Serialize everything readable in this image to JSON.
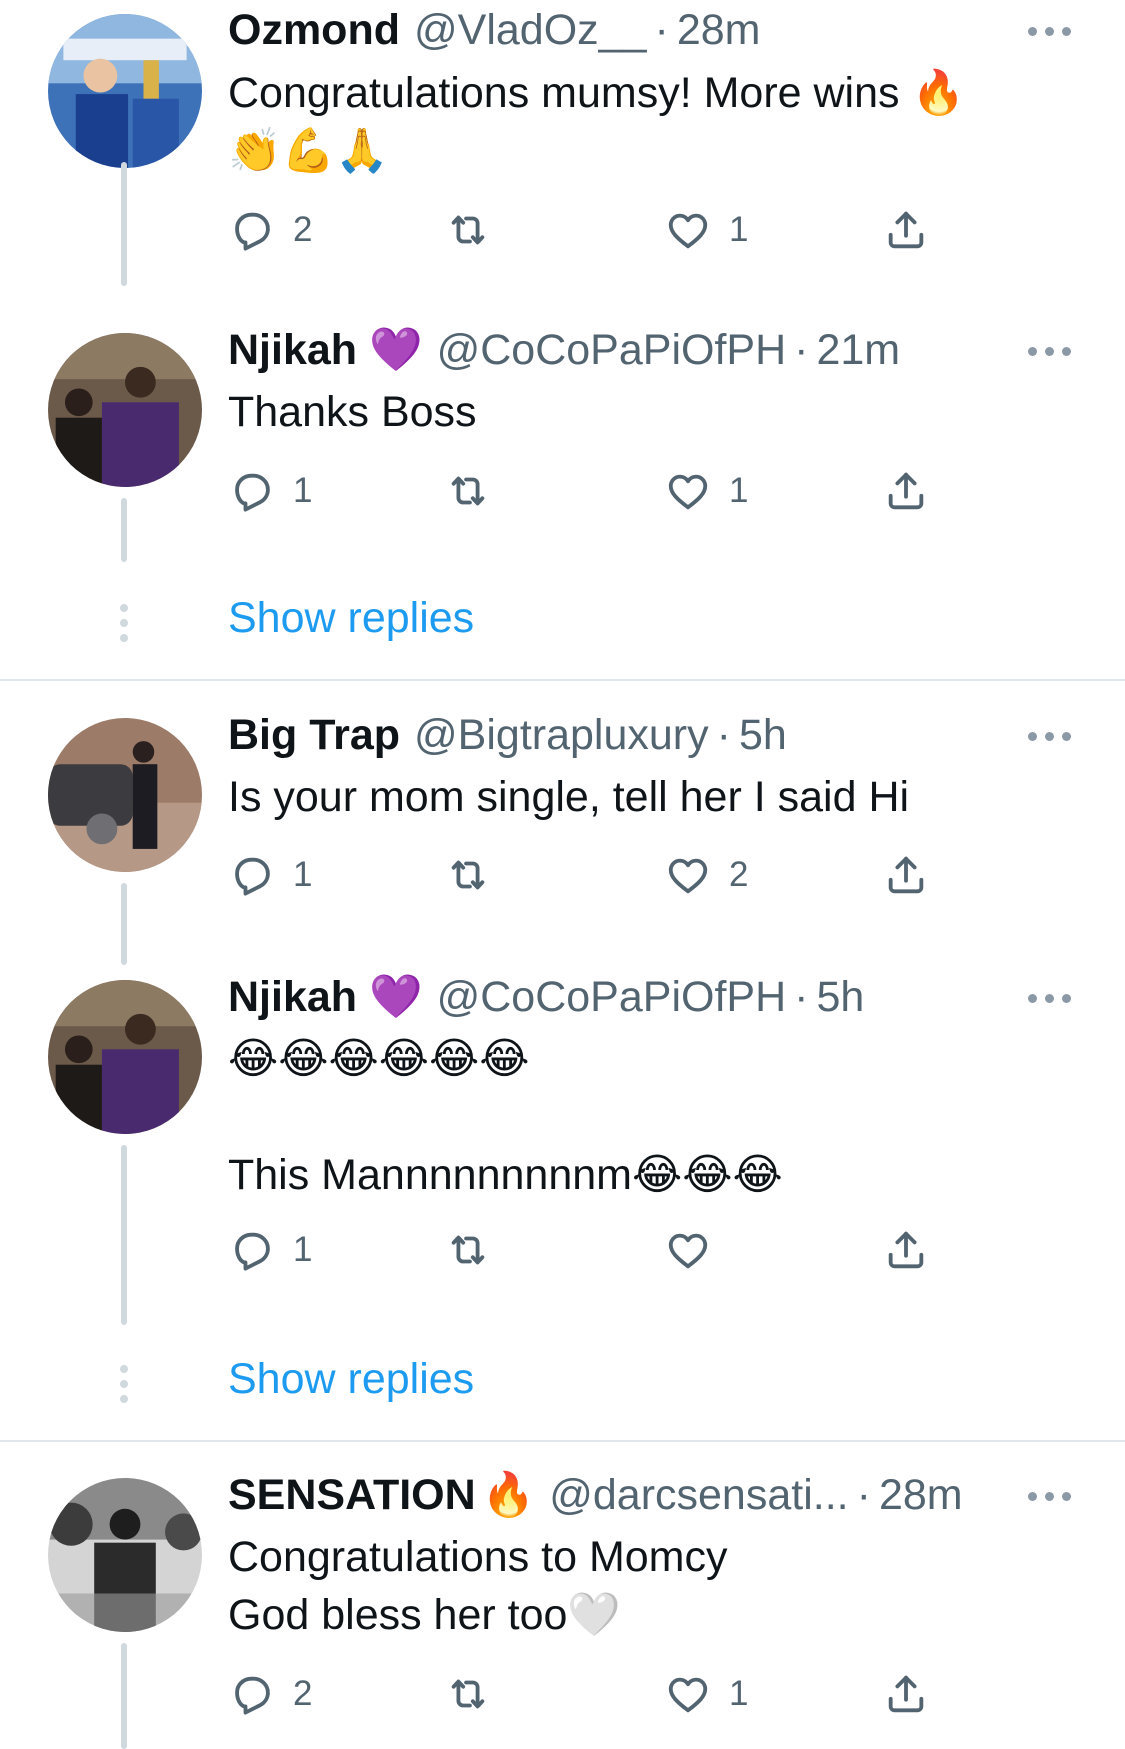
{
  "tweets": [
    {
      "name": "Ozmond",
      "handle": "@VladOz__",
      "separator": "·",
      "time": "28m",
      "name_emoji": "",
      "lines": [
        "Congratulations mumsy! More wins 🔥",
        "👏💪🙏"
      ],
      "replies": "2",
      "retweets": "",
      "likes": "1"
    },
    {
      "name": "Njikah",
      "handle": "@CoCoPaPiOfPH",
      "separator": "·",
      "time": "21m",
      "name_emoji": "💜",
      "lines": [
        "Thanks Boss"
      ],
      "replies": "1",
      "retweets": "",
      "likes": "1"
    },
    {
      "name": "Big Trap",
      "handle": "@Bigtrapluxury",
      "separator": "·",
      "time": "5h",
      "name_emoji": "",
      "lines": [
        "Is your mom single, tell her I said Hi"
      ],
      "replies": "1",
      "retweets": "",
      "likes": "2"
    },
    {
      "name": "Njikah",
      "handle": "@CoCoPaPiOfPH",
      "separator": "·",
      "time": "5h",
      "name_emoji": "💜",
      "lines": [
        "😂😂😂😂😂😂",
        "This Mannnnnnnnnm😂😂😂"
      ],
      "replies": "1",
      "retweets": "",
      "likes": ""
    },
    {
      "name": "SENSATION",
      "handle": "@darcsensati...",
      "separator": "·",
      "time": "28m",
      "name_emoji": "🔥",
      "lines": [
        "Congratulations to Momcy",
        "God bless her too🤍"
      ],
      "replies": "2",
      "retweets": "",
      "likes": "1"
    }
  ],
  "show_replies_label": "Show replies",
  "colors": {
    "link": "#1d9bf0",
    "secondary_text": "#536471",
    "thread_line": "#cfd9de",
    "icon": "#536471"
  },
  "icons": [
    "reply-icon",
    "retweet-icon",
    "like-icon",
    "share-icon",
    "more-icon"
  ]
}
